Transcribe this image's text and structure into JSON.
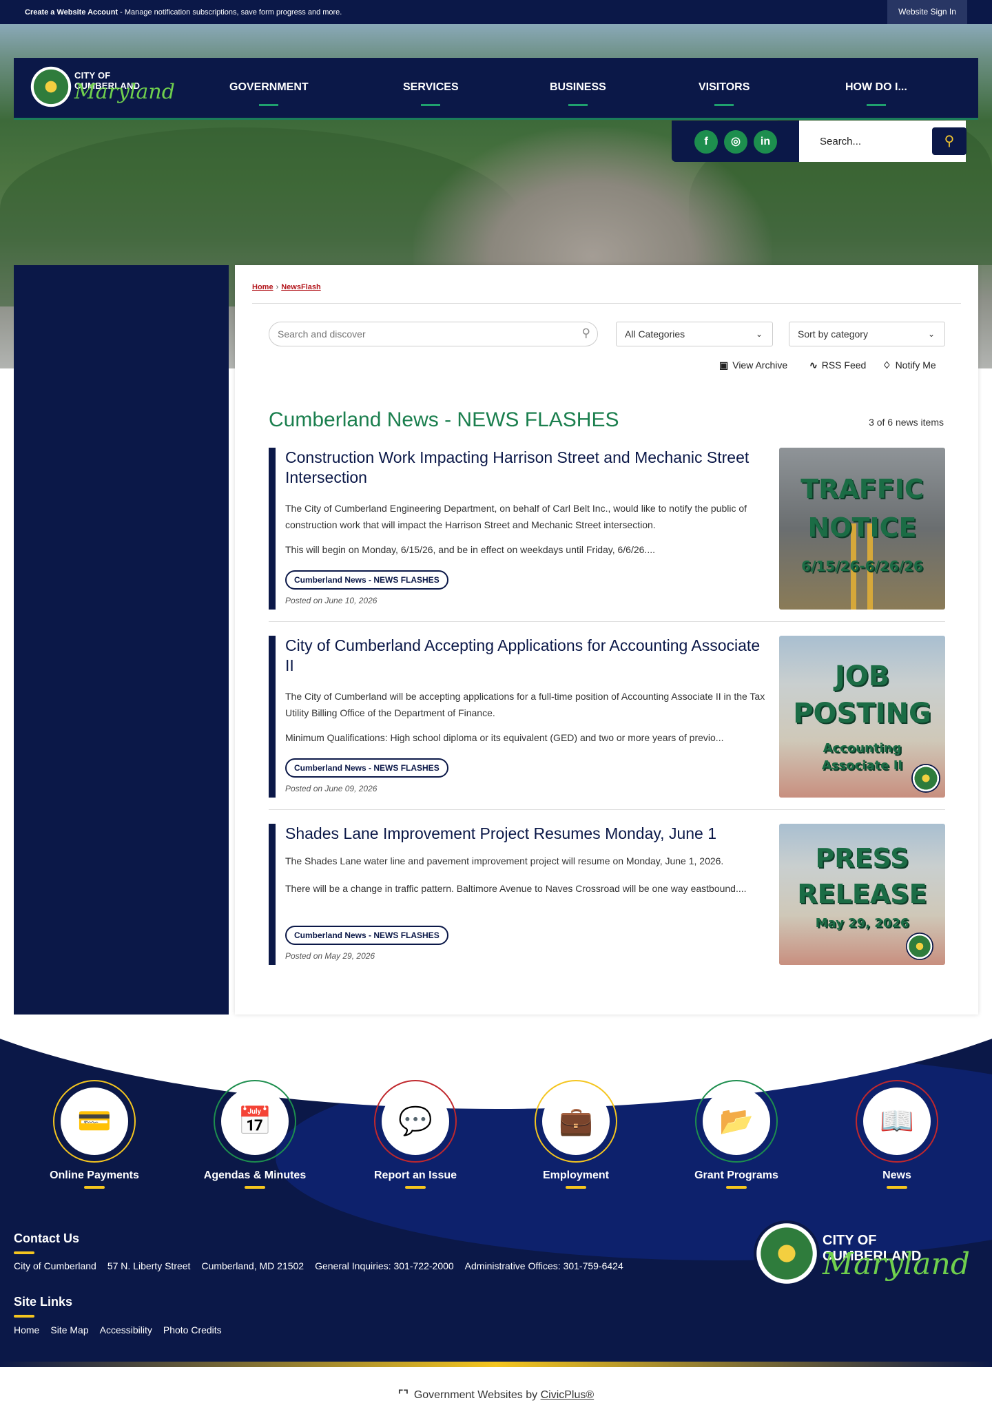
{
  "topbar": {
    "create_label": "Create a Website Account",
    "create_desc": " - Manage notification subscriptions, save form progress and more.",
    "signin_label": "Website Sign In"
  },
  "logo": {
    "line1": "CITY OF CUMBERLAND",
    "line2": "Maryland"
  },
  "nav": {
    "items": [
      {
        "label": "GOVERNMENT"
      },
      {
        "label": "SERVICES"
      },
      {
        "label": "BUSINESS"
      },
      {
        "label": "VISITORS"
      },
      {
        "label": "HOW DO I..."
      }
    ]
  },
  "social": {
    "facebook": "f",
    "instagram": "◎",
    "linkedin": "in"
  },
  "site_search": {
    "placeholder": "Search..."
  },
  "breadcrumb": {
    "home": "Home",
    "sep": "›",
    "current": "NewsFlash"
  },
  "filters": {
    "search_placeholder": "Search and discover",
    "category": "All Categories",
    "sort": "Sort by category"
  },
  "actions": {
    "archive": "View Archive",
    "rss": "RSS Feed",
    "notify": "Notify Me"
  },
  "page": {
    "title": "Cumberland News - NEWS FLASHES",
    "count": "3 of 6 news items"
  },
  "news": [
    {
      "title": "Construction Work Impacting Harrison Street and Mechanic Street Intersection",
      "p1": "The City of Cumberland Engineering Department, on behalf of Carl Belt Inc., would like to notify the public of construction work that will impact the Harrison Street and Mechanic Street intersection.",
      "p2": "This will begin on Monday, 6/15/26, and be in effect on weekdays until Friday, 6/6/26....",
      "tag": "Cumberland News - NEWS FLASHES",
      "date": "Posted on June 10, 2026",
      "thumb": {
        "l1": "TRAFFIC",
        "l2": "NOTICE",
        "l3": "6/15/26-6/26/26"
      }
    },
    {
      "title": "City of Cumberland Accepting Applications for Accounting Associate II",
      "p1": "The City of Cumberland will be accepting applications for a full-time position of Accounting Associate II in the Tax Utility Billing Office of the Department of Finance.",
      "p2": "Minimum Qualifications: High school diploma or its equivalent (GED) and two or more years of previo...",
      "tag": "Cumberland News - NEWS FLASHES",
      "date": "Posted on June 09, 2026",
      "thumb": {
        "l1": "JOB",
        "l2": "POSTING",
        "l3": "Accounting",
        "l4": "Associate II"
      }
    },
    {
      "title": "Shades Lane Improvement Project Resumes Monday, June 1",
      "p1": "The Shades Lane water line and pavement improvement project will resume on Monday, June 1, 2026.",
      "p2": "There will be a change in traffic pattern. Baltimore Avenue to Naves Crossroad will be one way eastbound....",
      "tag": "Cumberland News - NEWS FLASHES",
      "date": "Posted on May 29, 2026",
      "thumb": {
        "l1": "PRESS",
        "l2": "RELEASE",
        "l3": "May 29, 2026"
      }
    }
  ],
  "quicklinks": [
    {
      "label": "Online Payments",
      "icon": "💳",
      "ring": "#f4c51f"
    },
    {
      "label": "Agendas & Minutes",
      "icon": "📅",
      "ring": "#1d8e4e"
    },
    {
      "label": "Report an Issue",
      "icon": "💬",
      "ring": "#c0282d"
    },
    {
      "label": "Employment",
      "icon": "💼",
      "ring": "#f4c51f"
    },
    {
      "label": "Grant Programs",
      "icon": "📂",
      "ring": "#1d8e4e"
    },
    {
      "label": "News",
      "icon": "📖",
      "ring": "#c0282d"
    }
  ],
  "contact": {
    "heading": "Contact Us",
    "items": [
      "City of Cumberland",
      "57 N. Liberty Street",
      "Cumberland, MD 21502",
      "General Inquiries: 301-722-2000",
      "Administrative Offices: 301-759-6424"
    ]
  },
  "sitelinks": {
    "heading": "Site Links",
    "items": [
      "Home",
      "Site Map",
      "Accessibility",
      "Photo Credits"
    ]
  },
  "footer_logo": {
    "line1": "CITY OF CUMBERLAND",
    "line2": "Maryland"
  },
  "civic": {
    "prefix": "Government Websites by ",
    "link": "CivicPlus®"
  }
}
